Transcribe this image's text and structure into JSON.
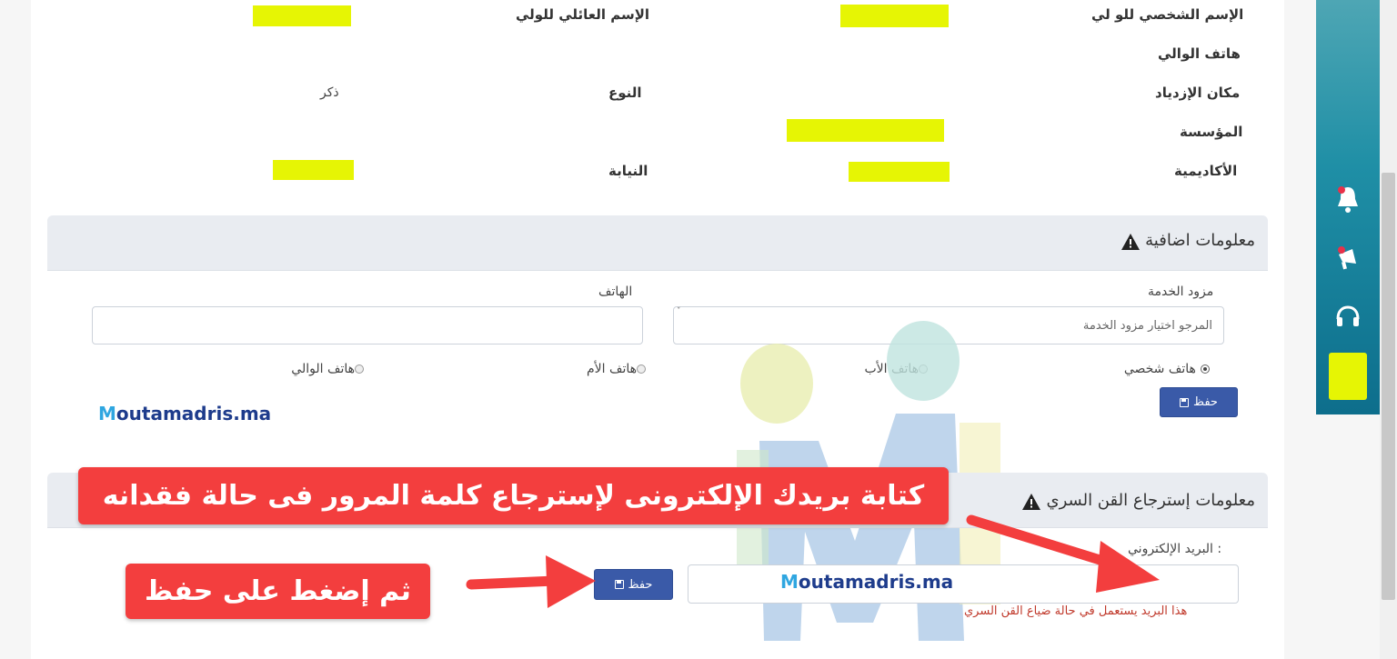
{
  "info": {
    "first_name_label": "الإسم الشخصي للو لي",
    "family_name_label": "الإسم العائلي للولي",
    "guardian_phone_label": "هاتف الوالي",
    "birthplace_label": "مكان الإزدياد",
    "gender_label": "النوع",
    "gender_value": "ذكر",
    "institution_label": "المؤسسة",
    "academy_label": "الأكاديمية",
    "directorate_label": "النيابة"
  },
  "extra_panel": {
    "title": "معلومات اضافية",
    "provider_label": "مزود الخدمة",
    "provider_placeholder": "المرجو اختيار مزود الخدمة",
    "phone_label": "الهاتف",
    "phone_value": "",
    "radios": [
      {
        "label": "هاتف شخصي",
        "checked": true
      },
      {
        "label": "هاتف الأب",
        "checked": false
      },
      {
        "label": "هاتف الأم",
        "checked": false
      },
      {
        "label": "هاتف الوالي",
        "checked": false
      }
    ],
    "save_label": "حفظ"
  },
  "recovery_panel": {
    "title": "معلومات إسترجاع القن السري",
    "email_label": "البريد الإلكتروني :",
    "email_value": "",
    "note": "هذا البريد يستعمل في حالة ضياع القن السري",
    "save_label": "حفظ"
  },
  "watermark": {
    "logo_text_m": "M",
    "logo_text_rest": "outamadris.ma"
  },
  "callouts": {
    "top": "كتابة بريدك الإلكترونى لإسترجاع كلمة المرور فى حالة فقدانه",
    "bottom": "ثم إضغط على حفظ"
  },
  "sidebar": {
    "icons": [
      "bell-icon",
      "megaphone-icon",
      "headset-icon"
    ]
  },
  "colors": {
    "highlight": "#e6f504",
    "button": "#3a5aa8",
    "callout": "#f33e3e",
    "sidebar": "#1f8fa6"
  }
}
